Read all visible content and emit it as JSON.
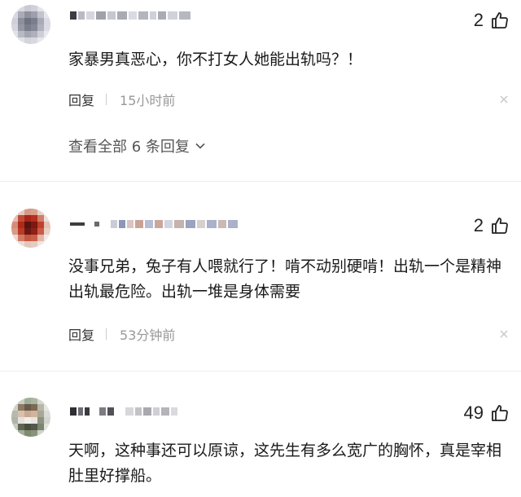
{
  "comments": [
    {
      "likes": "2",
      "content": "家暴男真恶心，你不打女人她能出轨吗？！",
      "reply_label": "回复",
      "time": "15小时前",
      "view_replies": "查看全部 6 条回复"
    },
    {
      "likes": "2",
      "content": "没事兄弟，兔子有人喂就行了！啃不动别硬啃！出轨一个是精神出轨最危险。出轨一堆是身体需要",
      "reply_label": "回复",
      "time": "53分钟前"
    },
    {
      "likes": "49",
      "content": "天啊，这种事还可以原谅，这先生有多么宽广的胸怀，真是宰相肚里好撑船。"
    }
  ],
  "icons": {
    "like": "thumbs-up-icon",
    "more": "more-icon",
    "chevron": "chevron-down-icon"
  },
  "colors": {
    "text": "#1a1a1a",
    "meta": "#999999",
    "divider": "#ececec"
  }
}
